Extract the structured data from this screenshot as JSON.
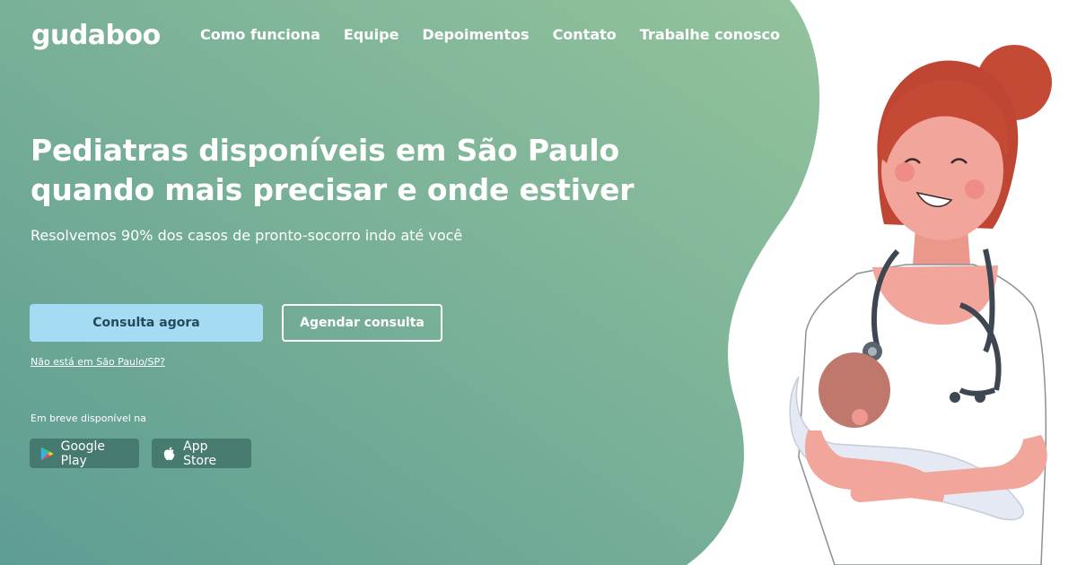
{
  "brand": {
    "name": "gudaboo"
  },
  "nav": {
    "items": [
      {
        "label": "Como funciona"
      },
      {
        "label": "Equipe"
      },
      {
        "label": "Depoimentos"
      },
      {
        "label": "Contato"
      },
      {
        "label": "Trabalhe conosco"
      }
    ]
  },
  "hero": {
    "headline_line1": "Pediatras disponíveis em São Paulo",
    "headline_line2": "quando mais precisar e onde estiver",
    "subtitle": "Resolvemos 90% dos casos de pronto-socorro indo até você",
    "primary_cta": "Consulta agora",
    "secondary_cta": "Agendar consulta",
    "region_link": "Não está em São Paulo/SP?",
    "coming_soon": "Em breve disponível na",
    "stores": [
      {
        "label": "Google Play",
        "icon": "google-play-icon"
      },
      {
        "label": "App Store",
        "icon": "apple-icon"
      }
    ]
  },
  "colors": {
    "gradient_start": "#5f9e94",
    "gradient_end": "#8ebf9b",
    "primary_button": "#a5dcf3",
    "primary_button_text": "#234b5a",
    "hair": "#c54a36",
    "skin": "#f2a59b",
    "baby_skin": "#c0786d",
    "blanket": "#e4e9f3"
  },
  "illustration": {
    "subject": "pediatrician-holding-baby"
  }
}
